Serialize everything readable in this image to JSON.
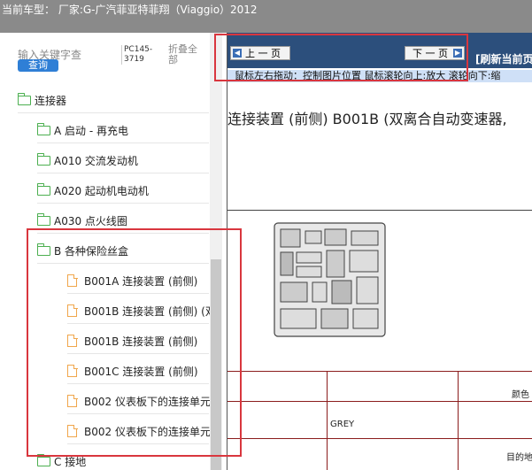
{
  "topbar": {
    "title": "当前车型：  厂家:G-广汽菲亚特菲翔（Viaggio）2012"
  },
  "search": {
    "placeholder": "输入关键字查",
    "button": "查询",
    "pc_code": "PC145-3719",
    "collapse_label": "折叠全部"
  },
  "tree": {
    "items": [
      {
        "label": "连接器",
        "icon": "folder-icon"
      },
      {
        "label": "A 启动 - 再充电",
        "icon": "folder-icon"
      },
      {
        "label": "A010 交流发动机",
        "icon": "folder-icon"
      },
      {
        "label": "A020 起动机电动机",
        "icon": "folder-icon"
      },
      {
        "label": "A030 点火线圈",
        "icon": "folder-icon"
      },
      {
        "label": "B 各种保险丝盒",
        "icon": "folder-icon"
      },
      {
        "label": "B001A 连接装置 (前侧)",
        "icon": "document-icon"
      },
      {
        "label": "B001B 连接装置 (前侧) (双",
        "icon": "document-icon"
      },
      {
        "label": "B001B 连接装置 (前侧)",
        "icon": "document-icon"
      },
      {
        "label": "B001C 连接装置 (前侧)",
        "icon": "document-icon"
      },
      {
        "label": "B002 仪表板下的连接单元",
        "icon": "document-icon"
      },
      {
        "label": "B002 仪表板下的连接单元",
        "icon": "document-icon"
      },
      {
        "label": "C 接地",
        "icon": "folder-icon"
      }
    ]
  },
  "viewer": {
    "prev_label": "上 一 页",
    "next_label": "下 一 页",
    "refresh_label": "[刷新当前页",
    "hint": "鼠标左右拖动：控制图片位置   鼠标滚轮向上:放大   滚轮向下:缩",
    "doc_title": "连接装置 (前侧)  B001B  (双离合自动变速器,",
    "table": {
      "color_header": "颜色",
      "grey": "GREY",
      "destination_header": "目的地"
    }
  },
  "colors": {
    "topbar": "#8a8a8a",
    "navbar": "#2c4f7c",
    "highlight": "#d9363e",
    "folder": "#4caf50",
    "document": "#f0a64b"
  }
}
